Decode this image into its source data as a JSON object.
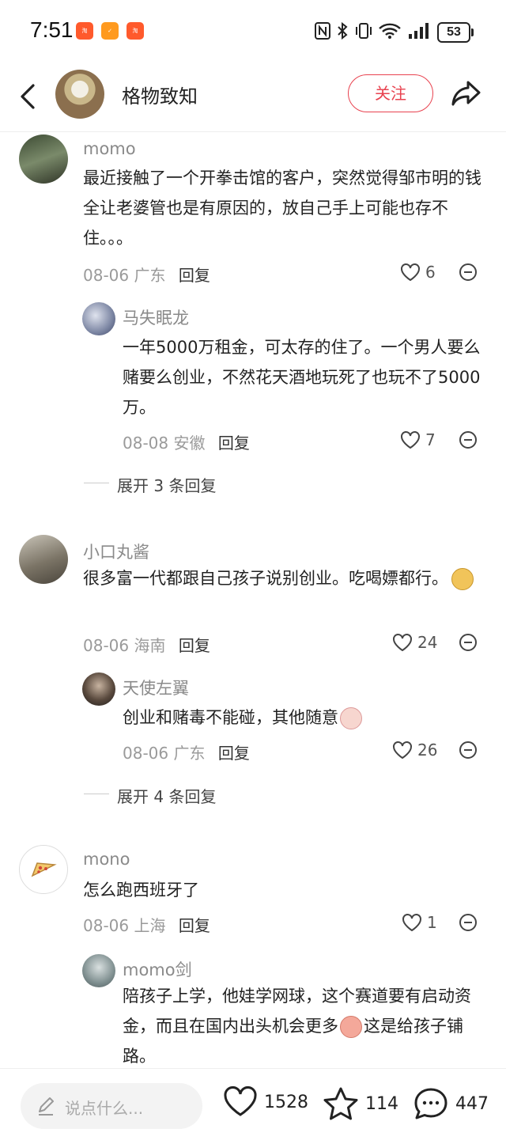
{
  "status": {
    "time": "7:51",
    "battery": "53"
  },
  "header": {
    "title": "格物致知",
    "follow": "关注"
  },
  "comments": [
    {
      "user": "momo",
      "text": "最近接触了一个开拳击馆的客户，突然觉得邹市明的钱全让老婆管也是有原因的，放自己手上可能也存不住。。。",
      "date": "08-06 广东",
      "reply": "回复",
      "likes": "6"
    },
    {
      "user": "马失眠龙",
      "text": "一年5000万租金，可太存的住了。一个男人要么赌要么创业，不然花天酒地玩死了也玩不了5000万。",
      "date": "08-08 安徽",
      "reply": "回复",
      "likes": "7"
    },
    {
      "expand": "展开 3 条回复"
    },
    {
      "user": "小口丸酱",
      "text": "很多富一代都跟自己孩子说别创业。吃喝嫖都行。",
      "date": "08-06 海南",
      "reply": "回复",
      "likes": "24"
    },
    {
      "user": "天使左翼",
      "text": "创业和赌毒不能碰，其他随意",
      "date": "08-06 广东",
      "reply": "回复",
      "likes": "26"
    },
    {
      "expand": "展开 4 条回复"
    },
    {
      "user": "mono",
      "text": "怎么跑西班牙了",
      "date": "08-06 上海",
      "reply": "回复",
      "likes": "1"
    },
    {
      "user": "momo剑",
      "text": "陪孩子上学，他娃学网球，这个赛道要有启动资金，而且在国内出头机会更多",
      "text2": "这是给孩子铺路。"
    }
  ],
  "bottom": {
    "placeholder": "说点什么...",
    "likes": "1528",
    "stars": "114",
    "comments": "447"
  }
}
